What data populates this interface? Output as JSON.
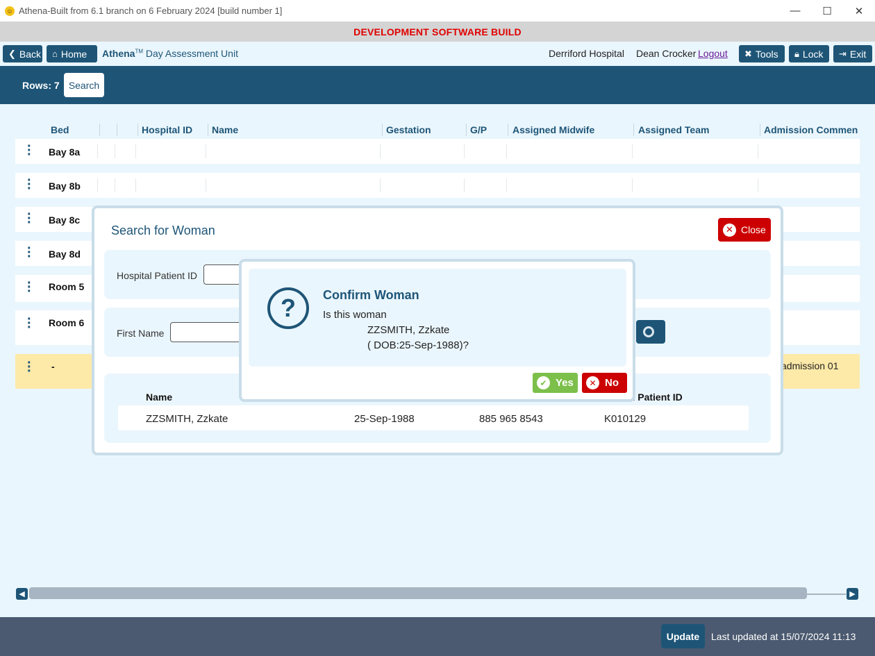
{
  "window": {
    "title": "Athena-Built from 6.1 branch on 6 February 2024 [build number 1]",
    "minimize": "—",
    "maximize": "☐",
    "close": "✕"
  },
  "banner": "DEVELOPMENT SOFTWARE BUILD",
  "nav": {
    "back": "Back",
    "home": "Home",
    "brand": "Athena",
    "brand_mark": "TM",
    "unit": "Day Assessment Unit",
    "hospital": "Derriford Hospital",
    "user": "Dean Crocker",
    "logout": "Logout",
    "tools": "Tools",
    "lock": "Lock",
    "exit": "Exit"
  },
  "toolbar": {
    "rows": "Rows: 7",
    "search": "Search"
  },
  "grid": {
    "columns": [
      "Bed",
      "Hospital ID",
      "Name",
      "Gestation",
      "G/P",
      "Assigned Midwife",
      "Assigned Team",
      "Admission Commen"
    ],
    "rows": [
      {
        "bed": "Bay 8a"
      },
      {
        "bed": "Bay 8b"
      },
      {
        "bed": "Bay 8c"
      },
      {
        "bed": "Bay 8d"
      },
      {
        "bed": "Room 5"
      },
      {
        "bed": "Room 6"
      },
      {
        "bed": "-",
        "comment": "admission 01"
      }
    ]
  },
  "footer": {
    "update": "Update",
    "last_updated": "Last updated at 15/07/2024 11:13"
  },
  "search_dialog": {
    "title": "Search for Woman",
    "close": "Close",
    "hospital_patient_id_label": "Hospital Patient ID",
    "first_name_label": "First Name",
    "results": {
      "headers": {
        "name": "Name",
        "patient_id": "tal Patient ID"
      },
      "row": {
        "name": "ZZSMITH, Zzkate",
        "dob": "25-Sep-1988",
        "nhs": "885 965 8543",
        "patient_id": "K010129"
      }
    }
  },
  "confirm_dialog": {
    "title": "Confirm Woman",
    "question": "Is this woman",
    "name": "ZZSMITH, Zzkate",
    "dob": "( DOB:25-Sep-1988)?",
    "yes": "Yes",
    "no": "No"
  }
}
